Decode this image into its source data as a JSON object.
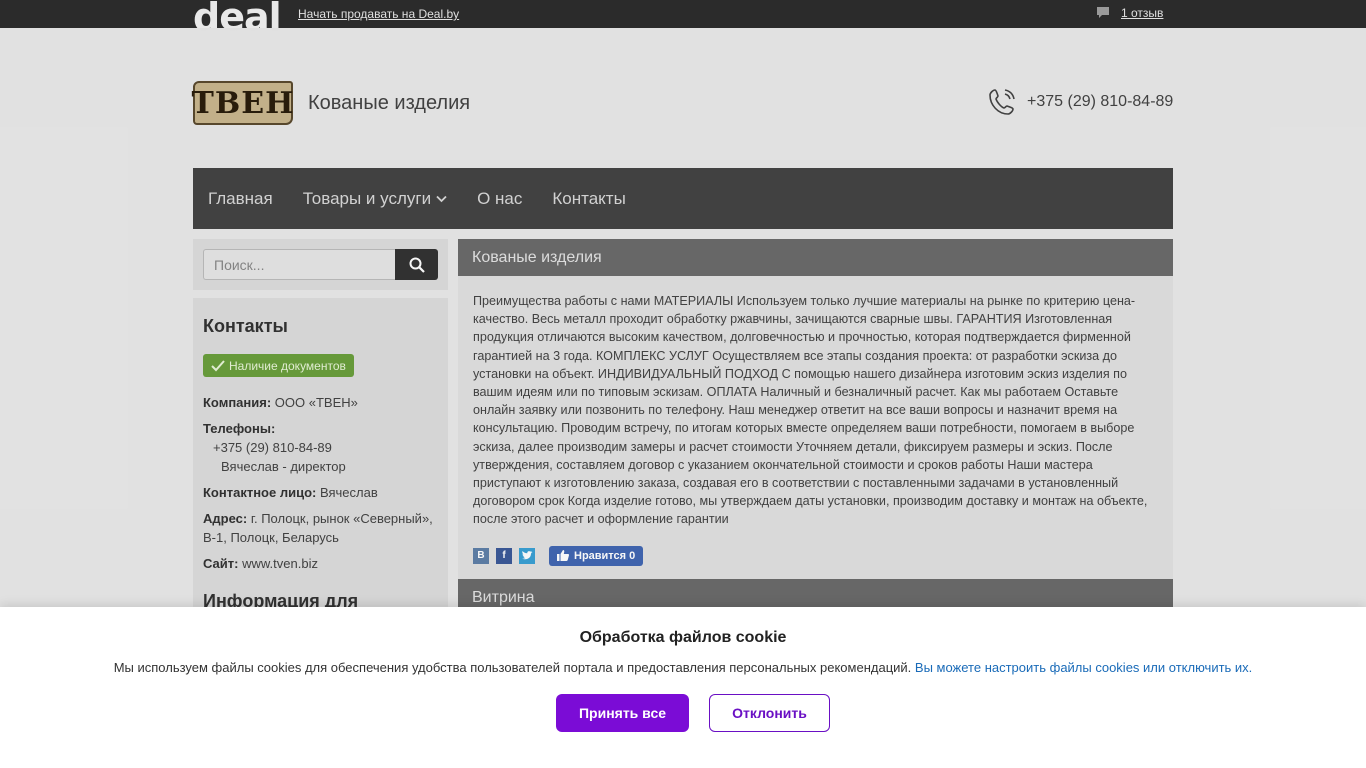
{
  "topbar": {
    "logo": "deal",
    "sell_link": "Начать продавать на Deal.by",
    "reviews": "1 отзыв"
  },
  "header": {
    "logo_text": "ТВЕН",
    "title": "Кованые изделия",
    "phone": "+375 (29) 810-84-89"
  },
  "nav": {
    "items": [
      {
        "label": "Главная"
      },
      {
        "label": "Товары и услуги"
      },
      {
        "label": "О нас"
      },
      {
        "label": "Контакты"
      }
    ]
  },
  "search": {
    "placeholder": "Поиск..."
  },
  "contacts": {
    "title": "Контакты",
    "badge": "Наличие документов",
    "company_label": "Компания:",
    "company_value": "ООО «ТВЕН»",
    "phones_label": "Телефоны:",
    "phone_number": "+375 (29) 810-84-89",
    "phone_person": "Вячеслав - директор",
    "person_label": "Контактное лицо:",
    "person_value": "Вячеслав",
    "address_label": "Адрес:",
    "address_value": "г. Полоцк, рынок «Северный», В-1, Полоцк, Беларусь",
    "site_label": "Сайт:",
    "site_value": "www.tven.biz",
    "info_title": "Информация для"
  },
  "main": {
    "title": "Кованые изделия",
    "body": "Преимущества работы с нами МАТЕРИАЛЫ Используем только лучшие материалы на рынке по критерию цена-качество. Весь металл проходит обработку ржавчины, зачищаются сварные швы. ГАРАНТИЯ Изготовленная продукция отличаются высоким качеством, долговечностью и прочностью, которая подтверждается фирменной гарантией на 3 года. КОМПЛЕКС УСЛУГ Осуществляем все этапы создания проекта: от разработки эскиза до установки на объект. ИНДИВИДУАЛЬНЫЙ ПОДХОД С помощью нашего дизайнера изготовим эскиз изделия по вашим идеям или по типовым эскизам. ОПЛАТА Наличный и безналичный расчет. Как мы работаем Оставьте онлайн заявку или позвонить по телефону. Наш менеджер ответит на все ваши вопросы и назначит время на консультацию. Проводим встречу, по итогам которых вместе определяем ваши потребности, помогаем в выборе эскиза, далее производим замеры и расчет стоимости Уточняем детали, фиксируем размеры и эскиз. После утверждения, составляем договор с указанием окончательной стоимости и сроков работы Наши мастера приступают к изготовлению заказа, создавая его в соответствии с поставленными задачами в установленный договором срок Когда изделие готово, мы утверждаем даты установки, производим доставку и монтаж на объекте, после этого расчет и оформление гарантии",
    "share_vk": "В",
    "share_fb": "f",
    "like_label": "Нравится 0",
    "vitrina_title": "Витрина"
  },
  "cookie": {
    "title": "Обработка файлов cookie",
    "text": "Мы используем файлы cookies для обеспечения удобства пользователей портала и предоставления персональных рекомендаций.",
    "link": "Вы можете настроить файлы cookies или отключить их.",
    "accept": "Принять все",
    "decline": "Отклонить"
  },
  "colors": {
    "topbar": "#2b2b2b",
    "nav": "#444444",
    "accent_purple": "#7b0cd6",
    "badge_green": "#6a9e3c",
    "link_blue": "#1a6bb8"
  }
}
